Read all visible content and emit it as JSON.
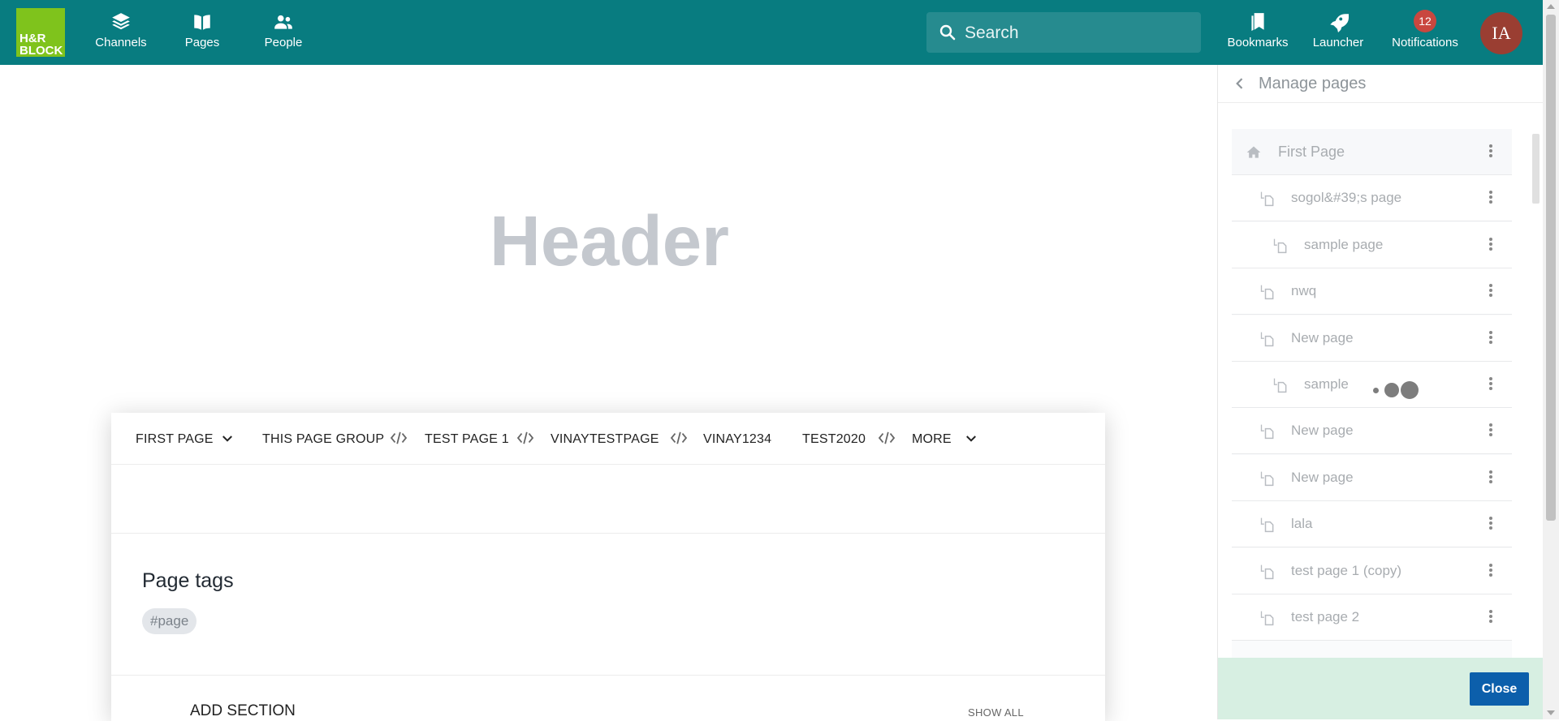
{
  "brand": {
    "logo_text": "H&R\nBLOCK"
  },
  "topnav": {
    "items": [
      {
        "label": "Channels",
        "icon": "layers-icon"
      },
      {
        "label": "Pages",
        "icon": "book-icon"
      },
      {
        "label": "People",
        "icon": "people-icon"
      }
    ],
    "right_items": [
      {
        "label": "Bookmarks",
        "icon": "bookmarks-icon"
      },
      {
        "label": "Launcher",
        "icon": "rocket-icon"
      },
      {
        "label": "Notifications",
        "icon": "bell-icon",
        "badge": "12"
      }
    ],
    "search_placeholder": "Search",
    "avatar_initials": "IA"
  },
  "main": {
    "header": "Header",
    "tabs": [
      {
        "label": "FIRST PAGE",
        "suffix": "chevron"
      },
      {
        "label": "THIS PAGE GROUP",
        "suffix": "code"
      },
      {
        "label": "TEST PAGE 1",
        "suffix": "code"
      },
      {
        "label": "VINAYTESTPAGE",
        "suffix": "code"
      },
      {
        "label": "VINAY1234",
        "suffix": "none"
      },
      {
        "label": "TEST2020",
        "suffix": "code"
      },
      {
        "label": "MORE",
        "suffix": "chevron"
      }
    ],
    "page_tags_title": "Page tags",
    "tags": [
      "#page"
    ],
    "add_section": "ADD SECTION",
    "show_all": "SHOW ALL"
  },
  "panel": {
    "title": "Manage pages",
    "pages": [
      {
        "label": "First Page",
        "level": 0,
        "root": true
      },
      {
        "label": "sogol&#39;s page",
        "level": 1
      },
      {
        "label": "sample page",
        "level": 2
      },
      {
        "label": "nwq",
        "level": 1
      },
      {
        "label": "New page",
        "level": 1
      },
      {
        "label": "sample",
        "level": 2,
        "loading": true
      },
      {
        "label": "New page",
        "level": 1
      },
      {
        "label": "New page",
        "level": 1
      },
      {
        "label": "lala",
        "level": 1
      },
      {
        "label": "test page 1 (copy)",
        "level": 1
      },
      {
        "label": "test page 2",
        "level": 1
      }
    ],
    "close_label": "Close"
  },
  "colors": {
    "topbar": "#087c80",
    "logo": "#7fc31c",
    "badge": "#c9473f",
    "avatar": "#9a3e32",
    "close_button": "#0c5fab",
    "footer": "#d7efe2"
  }
}
